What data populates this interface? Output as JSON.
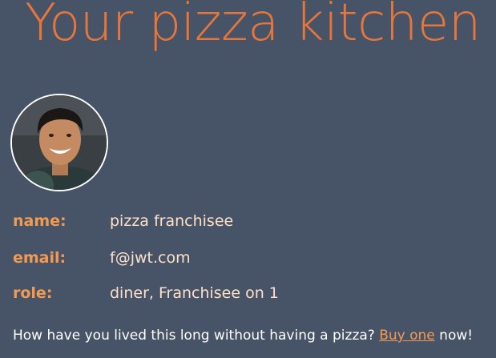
{
  "header": {
    "title": "Your pizza kitchen"
  },
  "profile": {
    "avatar_icon": "user-photo-icon",
    "fields": [
      {
        "label": "name:",
        "value": "pizza franchisee"
      },
      {
        "label": "email:",
        "value": "f@jwt.com"
      },
      {
        "label": "role:",
        "value": "diner, Franchisee on 1"
      }
    ]
  },
  "footer": {
    "text_before": "How have you lived this long without having a pizza? ",
    "link_label": "Buy one",
    "text_after": " now!"
  },
  "colors": {
    "background": "#475467",
    "accent": "#e8763a",
    "label": "#f39a52",
    "value": "#fde0c8"
  }
}
